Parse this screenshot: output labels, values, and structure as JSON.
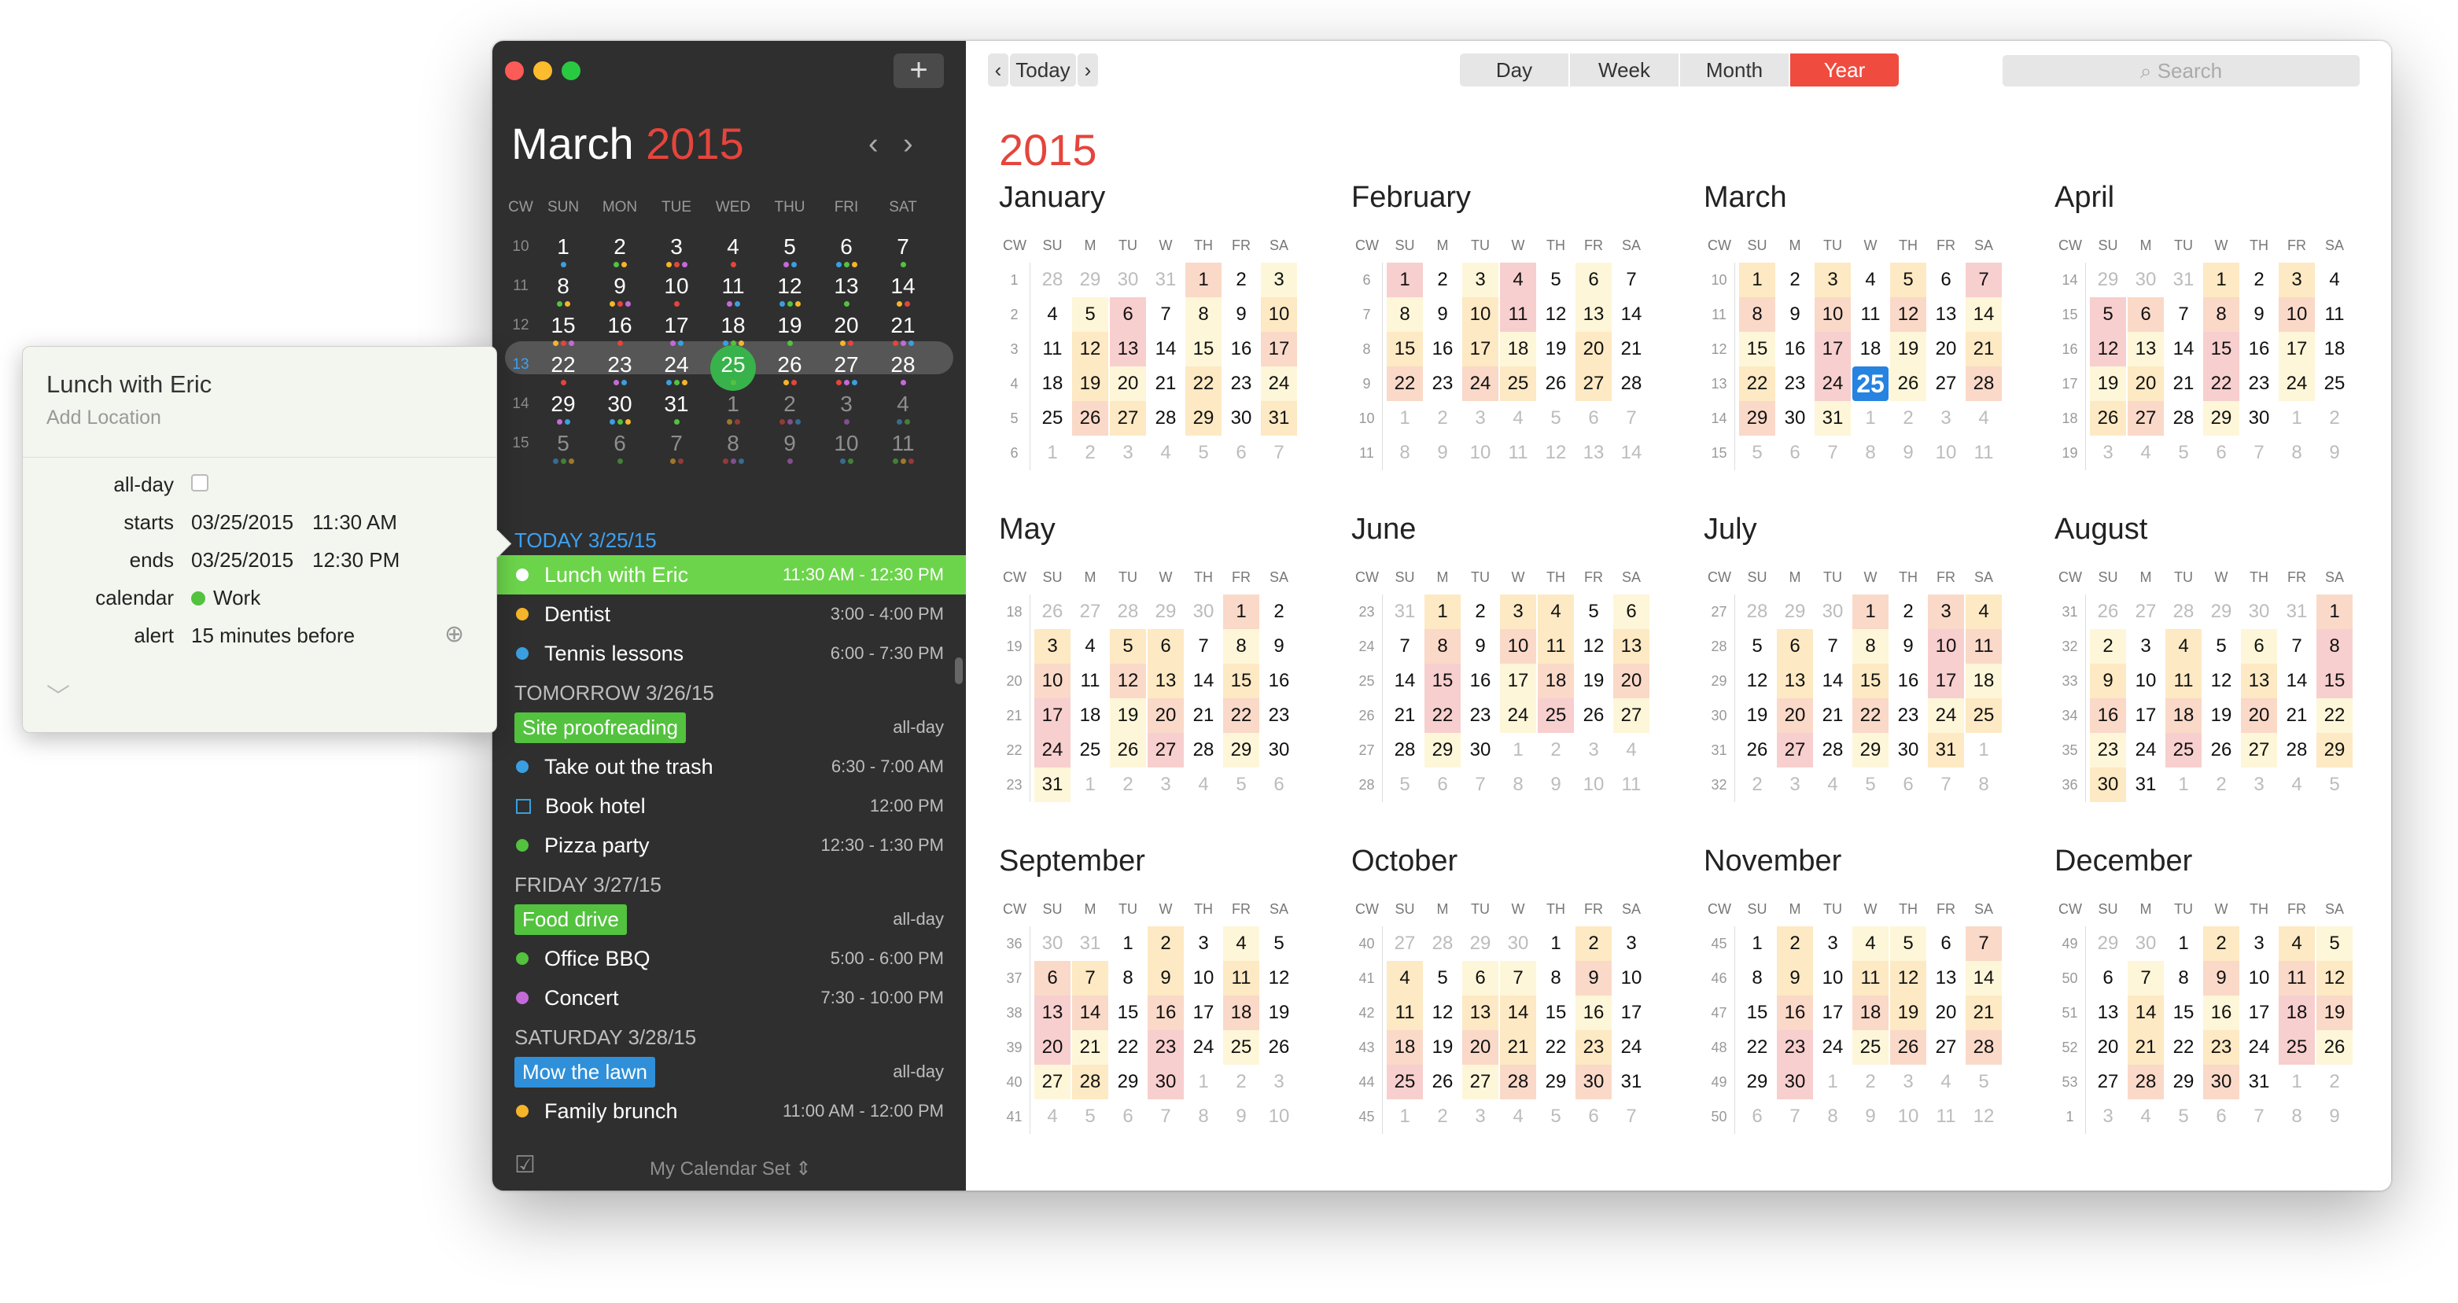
{
  "sidebar": {
    "month": "March",
    "year": "2015",
    "weekdays": [
      "CW",
      "SUN",
      "MON",
      "TUE",
      "WED",
      "THU",
      "FRI",
      "SAT"
    ],
    "weeks": [
      {
        "cw": "10",
        "days": [
          "1",
          "2",
          "3",
          "4",
          "5",
          "6",
          "7"
        ]
      },
      {
        "cw": "11",
        "days": [
          "8",
          "9",
          "10",
          "11",
          "12",
          "13",
          "14"
        ]
      },
      {
        "cw": "12",
        "days": [
          "15",
          "16",
          "17",
          "18",
          "19",
          "20",
          "21"
        ]
      },
      {
        "cw": "13",
        "days": [
          "22",
          "23",
          "24",
          "25",
          "26",
          "27",
          "28"
        ]
      },
      {
        "cw": "14",
        "days": [
          "29",
          "30",
          "31",
          "1",
          "2",
          "3",
          "4"
        ]
      },
      {
        "cw": "15",
        "days": [
          "5",
          "6",
          "7",
          "8",
          "9",
          "10",
          "11"
        ]
      }
    ],
    "agenda": [
      {
        "header": "TODAY 3/25/15",
        "today": true,
        "items": [
          {
            "title": "Lunch with Eric",
            "time": "11:30 AM - 12:30 PM",
            "color": "#ffffff",
            "selected": true
          },
          {
            "title": "Dentist",
            "time": "3:00 - 4:00 PM",
            "color": "#f6b42a"
          },
          {
            "title": "Tennis lessons",
            "time": "6:00 - 7:30 PM",
            "color": "#3a9fe0"
          }
        ]
      },
      {
        "header": "TOMORROW 3/26/15",
        "items": [
          {
            "title": "Site proofreading",
            "time": "all-day",
            "chip": "#53c23e"
          },
          {
            "title": "Take out the trash",
            "time": "6:30 - 7:00 AM",
            "color": "#3a9fe0"
          },
          {
            "title": "Book hotel",
            "time": "12:00 PM",
            "task": true
          },
          {
            "title": "Pizza party",
            "time": "12:30 - 1:30 PM",
            "color": "#53c23e"
          }
        ]
      },
      {
        "header": "FRIDAY 3/27/15",
        "items": [
          {
            "title": "Food drive",
            "time": "all-day",
            "chip": "#53c23e"
          },
          {
            "title": "Office BBQ",
            "time": "5:00 - 6:00 PM",
            "color": "#53c23e"
          },
          {
            "title": "Concert",
            "time": "7:30 - 10:00 PM",
            "color": "#c46ad8"
          }
        ]
      },
      {
        "header": "SATURDAY 3/28/15",
        "items": [
          {
            "title": "Mow the lawn",
            "time": "all-day",
            "chip": "#2f90d9"
          },
          {
            "title": "Family brunch",
            "time": "11:00 AM - 12:00 PM",
            "color": "#f6b42a"
          }
        ]
      }
    ],
    "calendar_set": "My Calendar Set ⇕"
  },
  "toolbar": {
    "today": "Today",
    "views": [
      "Day",
      "Week",
      "Month",
      "Year"
    ],
    "active_view": "Year",
    "search_placeholder": "Search"
  },
  "year_title": "2015",
  "weekday_short": [
    "CW",
    "SU",
    "M",
    "TU",
    "W",
    "TH",
    "FR",
    "SA"
  ],
  "months": [
    {
      "name": "January",
      "weeks": [
        [
          "1",
          "28",
          "29",
          "30",
          "31",
          "1",
          "2",
          "3"
        ],
        [
          "2",
          "4",
          "5",
          "6",
          "7",
          "8",
          "9",
          "10"
        ],
        [
          "3",
          "11",
          "12",
          "13",
          "14",
          "15",
          "16",
          "17"
        ],
        [
          "4",
          "18",
          "19",
          "20",
          "21",
          "22",
          "23",
          "24"
        ],
        [
          "5",
          "25",
          "26",
          "27",
          "28",
          "29",
          "30",
          "31"
        ],
        [
          "6",
          "1",
          "2",
          "3",
          "4",
          "5",
          "6",
          "7"
        ]
      ]
    },
    {
      "name": "February",
      "weeks": [
        [
          "6",
          "1",
          "2",
          "3",
          "4",
          "5",
          "6",
          "7"
        ],
        [
          "7",
          "8",
          "9",
          "10",
          "11",
          "12",
          "13",
          "14"
        ],
        [
          "8",
          "15",
          "16",
          "17",
          "18",
          "19",
          "20",
          "21"
        ],
        [
          "9",
          "22",
          "23",
          "24",
          "25",
          "26",
          "27",
          "28"
        ],
        [
          "10",
          "1",
          "2",
          "3",
          "4",
          "5",
          "6",
          "7"
        ],
        [
          "11",
          "8",
          "9",
          "10",
          "11",
          "12",
          "13",
          "14"
        ]
      ]
    },
    {
      "name": "March",
      "weeks": [
        [
          "10",
          "1",
          "2",
          "3",
          "4",
          "5",
          "6",
          "7"
        ],
        [
          "11",
          "8",
          "9",
          "10",
          "11",
          "12",
          "13",
          "14"
        ],
        [
          "12",
          "15",
          "16",
          "17",
          "18",
          "19",
          "20",
          "21"
        ],
        [
          "13",
          "22",
          "23",
          "24",
          "25",
          "26",
          "27",
          "28"
        ],
        [
          "14",
          "29",
          "30",
          "31",
          "1",
          "2",
          "3",
          "4"
        ],
        [
          "15",
          "5",
          "6",
          "7",
          "8",
          "9",
          "10",
          "11"
        ]
      ]
    },
    {
      "name": "April",
      "weeks": [
        [
          "14",
          "29",
          "30",
          "31",
          "1",
          "2",
          "3",
          "4"
        ],
        [
          "15",
          "5",
          "6",
          "7",
          "8",
          "9",
          "10",
          "11"
        ],
        [
          "16",
          "12",
          "13",
          "14",
          "15",
          "16",
          "17",
          "18"
        ],
        [
          "17",
          "19",
          "20",
          "21",
          "22",
          "23",
          "24",
          "25"
        ],
        [
          "18",
          "26",
          "27",
          "28",
          "29",
          "30",
          "1",
          "2"
        ],
        [
          "19",
          "3",
          "4",
          "5",
          "6",
          "7",
          "8",
          "9"
        ]
      ]
    },
    {
      "name": "May",
      "weeks": [
        [
          "18",
          "26",
          "27",
          "28",
          "29",
          "30",
          "1",
          "2"
        ],
        [
          "19",
          "3",
          "4",
          "5",
          "6",
          "7",
          "8",
          "9"
        ],
        [
          "20",
          "10",
          "11",
          "12",
          "13",
          "14",
          "15",
          "16"
        ],
        [
          "21",
          "17",
          "18",
          "19",
          "20",
          "21",
          "22",
          "23"
        ],
        [
          "22",
          "24",
          "25",
          "26",
          "27",
          "28",
          "29",
          "30"
        ],
        [
          "23",
          "31",
          "1",
          "2",
          "3",
          "4",
          "5",
          "6"
        ]
      ]
    },
    {
      "name": "June",
      "weeks": [
        [
          "23",
          "31",
          "1",
          "2",
          "3",
          "4",
          "5",
          "6"
        ],
        [
          "24",
          "7",
          "8",
          "9",
          "10",
          "11",
          "12",
          "13"
        ],
        [
          "25",
          "14",
          "15",
          "16",
          "17",
          "18",
          "19",
          "20"
        ],
        [
          "26",
          "21",
          "22",
          "23",
          "24",
          "25",
          "26",
          "27"
        ],
        [
          "27",
          "28",
          "29",
          "30",
          "1",
          "2",
          "3",
          "4"
        ],
        [
          "28",
          "5",
          "6",
          "7",
          "8",
          "9",
          "10",
          "11"
        ]
      ]
    },
    {
      "name": "July",
      "weeks": [
        [
          "27",
          "28",
          "29",
          "30",
          "1",
          "2",
          "3",
          "4"
        ],
        [
          "28",
          "5",
          "6",
          "7",
          "8",
          "9",
          "10",
          "11"
        ],
        [
          "29",
          "12",
          "13",
          "14",
          "15",
          "16",
          "17",
          "18"
        ],
        [
          "30",
          "19",
          "20",
          "21",
          "22",
          "23",
          "24",
          "25"
        ],
        [
          "31",
          "26",
          "27",
          "28",
          "29",
          "30",
          "31",
          "1"
        ],
        [
          "32",
          "2",
          "3",
          "4",
          "5",
          "6",
          "7",
          "8"
        ]
      ]
    },
    {
      "name": "August",
      "weeks": [
        [
          "31",
          "26",
          "27",
          "28",
          "29",
          "30",
          "31",
          "1"
        ],
        [
          "32",
          "2",
          "3",
          "4",
          "5",
          "6",
          "7",
          "8"
        ],
        [
          "33",
          "9",
          "10",
          "11",
          "12",
          "13",
          "14",
          "15"
        ],
        [
          "34",
          "16",
          "17",
          "18",
          "19",
          "20",
          "21",
          "22"
        ],
        [
          "35",
          "23",
          "24",
          "25",
          "26",
          "27",
          "28",
          "29"
        ],
        [
          "36",
          "30",
          "31",
          "1",
          "2",
          "3",
          "4",
          "5"
        ]
      ]
    },
    {
      "name": "September",
      "weeks": [
        [
          "36",
          "30",
          "31",
          "1",
          "2",
          "3",
          "4",
          "5"
        ],
        [
          "37",
          "6",
          "7",
          "8",
          "9",
          "10",
          "11",
          "12"
        ],
        [
          "38",
          "13",
          "14",
          "15",
          "16",
          "17",
          "18",
          "19"
        ],
        [
          "39",
          "20",
          "21",
          "22",
          "23",
          "24",
          "25",
          "26"
        ],
        [
          "40",
          "27",
          "28",
          "29",
          "30",
          "1",
          "2",
          "3"
        ],
        [
          "41",
          "4",
          "5",
          "6",
          "7",
          "8",
          "9",
          "10"
        ]
      ]
    },
    {
      "name": "October",
      "weeks": [
        [
          "40",
          "27",
          "28",
          "29",
          "30",
          "1",
          "2",
          "3"
        ],
        [
          "41",
          "4",
          "5",
          "6",
          "7",
          "8",
          "9",
          "10"
        ],
        [
          "42",
          "11",
          "12",
          "13",
          "14",
          "15",
          "16",
          "17"
        ],
        [
          "43",
          "18",
          "19",
          "20",
          "21",
          "22",
          "23",
          "24"
        ],
        [
          "44",
          "25",
          "26",
          "27",
          "28",
          "29",
          "30",
          "31"
        ],
        [
          "45",
          "1",
          "2",
          "3",
          "4",
          "5",
          "6",
          "7"
        ]
      ]
    },
    {
      "name": "November",
      "weeks": [
        [
          "45",
          "1",
          "2",
          "3",
          "4",
          "5",
          "6",
          "7"
        ],
        [
          "46",
          "8",
          "9",
          "10",
          "11",
          "12",
          "13",
          "14"
        ],
        [
          "47",
          "15",
          "16",
          "17",
          "18",
          "19",
          "20",
          "21"
        ],
        [
          "48",
          "22",
          "23",
          "24",
          "25",
          "26",
          "27",
          "28"
        ],
        [
          "49",
          "29",
          "30",
          "1",
          "2",
          "3",
          "4",
          "5"
        ],
        [
          "50",
          "6",
          "7",
          "8",
          "9",
          "10",
          "11",
          "12"
        ]
      ]
    },
    {
      "name": "December",
      "weeks": [
        [
          "49",
          "29",
          "30",
          "1",
          "2",
          "3",
          "4",
          "5"
        ],
        [
          "50",
          "6",
          "7",
          "8",
          "9",
          "10",
          "11",
          "12"
        ],
        [
          "51",
          "13",
          "14",
          "15",
          "16",
          "17",
          "18",
          "19"
        ],
        [
          "52",
          "20",
          "21",
          "22",
          "23",
          "24",
          "25",
          "26"
        ],
        [
          "53",
          "27",
          "28",
          "29",
          "30",
          "31",
          "1",
          "2"
        ],
        [
          "1",
          "3",
          "4",
          "5",
          "6",
          "7",
          "8",
          "9"
        ]
      ]
    }
  ],
  "popover": {
    "title": "Lunch with Eric",
    "location_placeholder": "Add Location",
    "allday_label": "all-day",
    "starts_label": "starts",
    "start_date": "03/25/2015",
    "start_time": "11:30 AM",
    "ends_label": "ends",
    "end_date": "03/25/2015",
    "end_time": "12:30 PM",
    "calendar_label": "calendar",
    "calendar_value": "Work",
    "calendar_color": "#53c23e",
    "alert_label": "alert",
    "alert_value": "15 minutes before"
  },
  "colors": {
    "accent": "#e5453c",
    "today_blue": "#2683e0",
    "selection_green": "#6cd44b"
  }
}
